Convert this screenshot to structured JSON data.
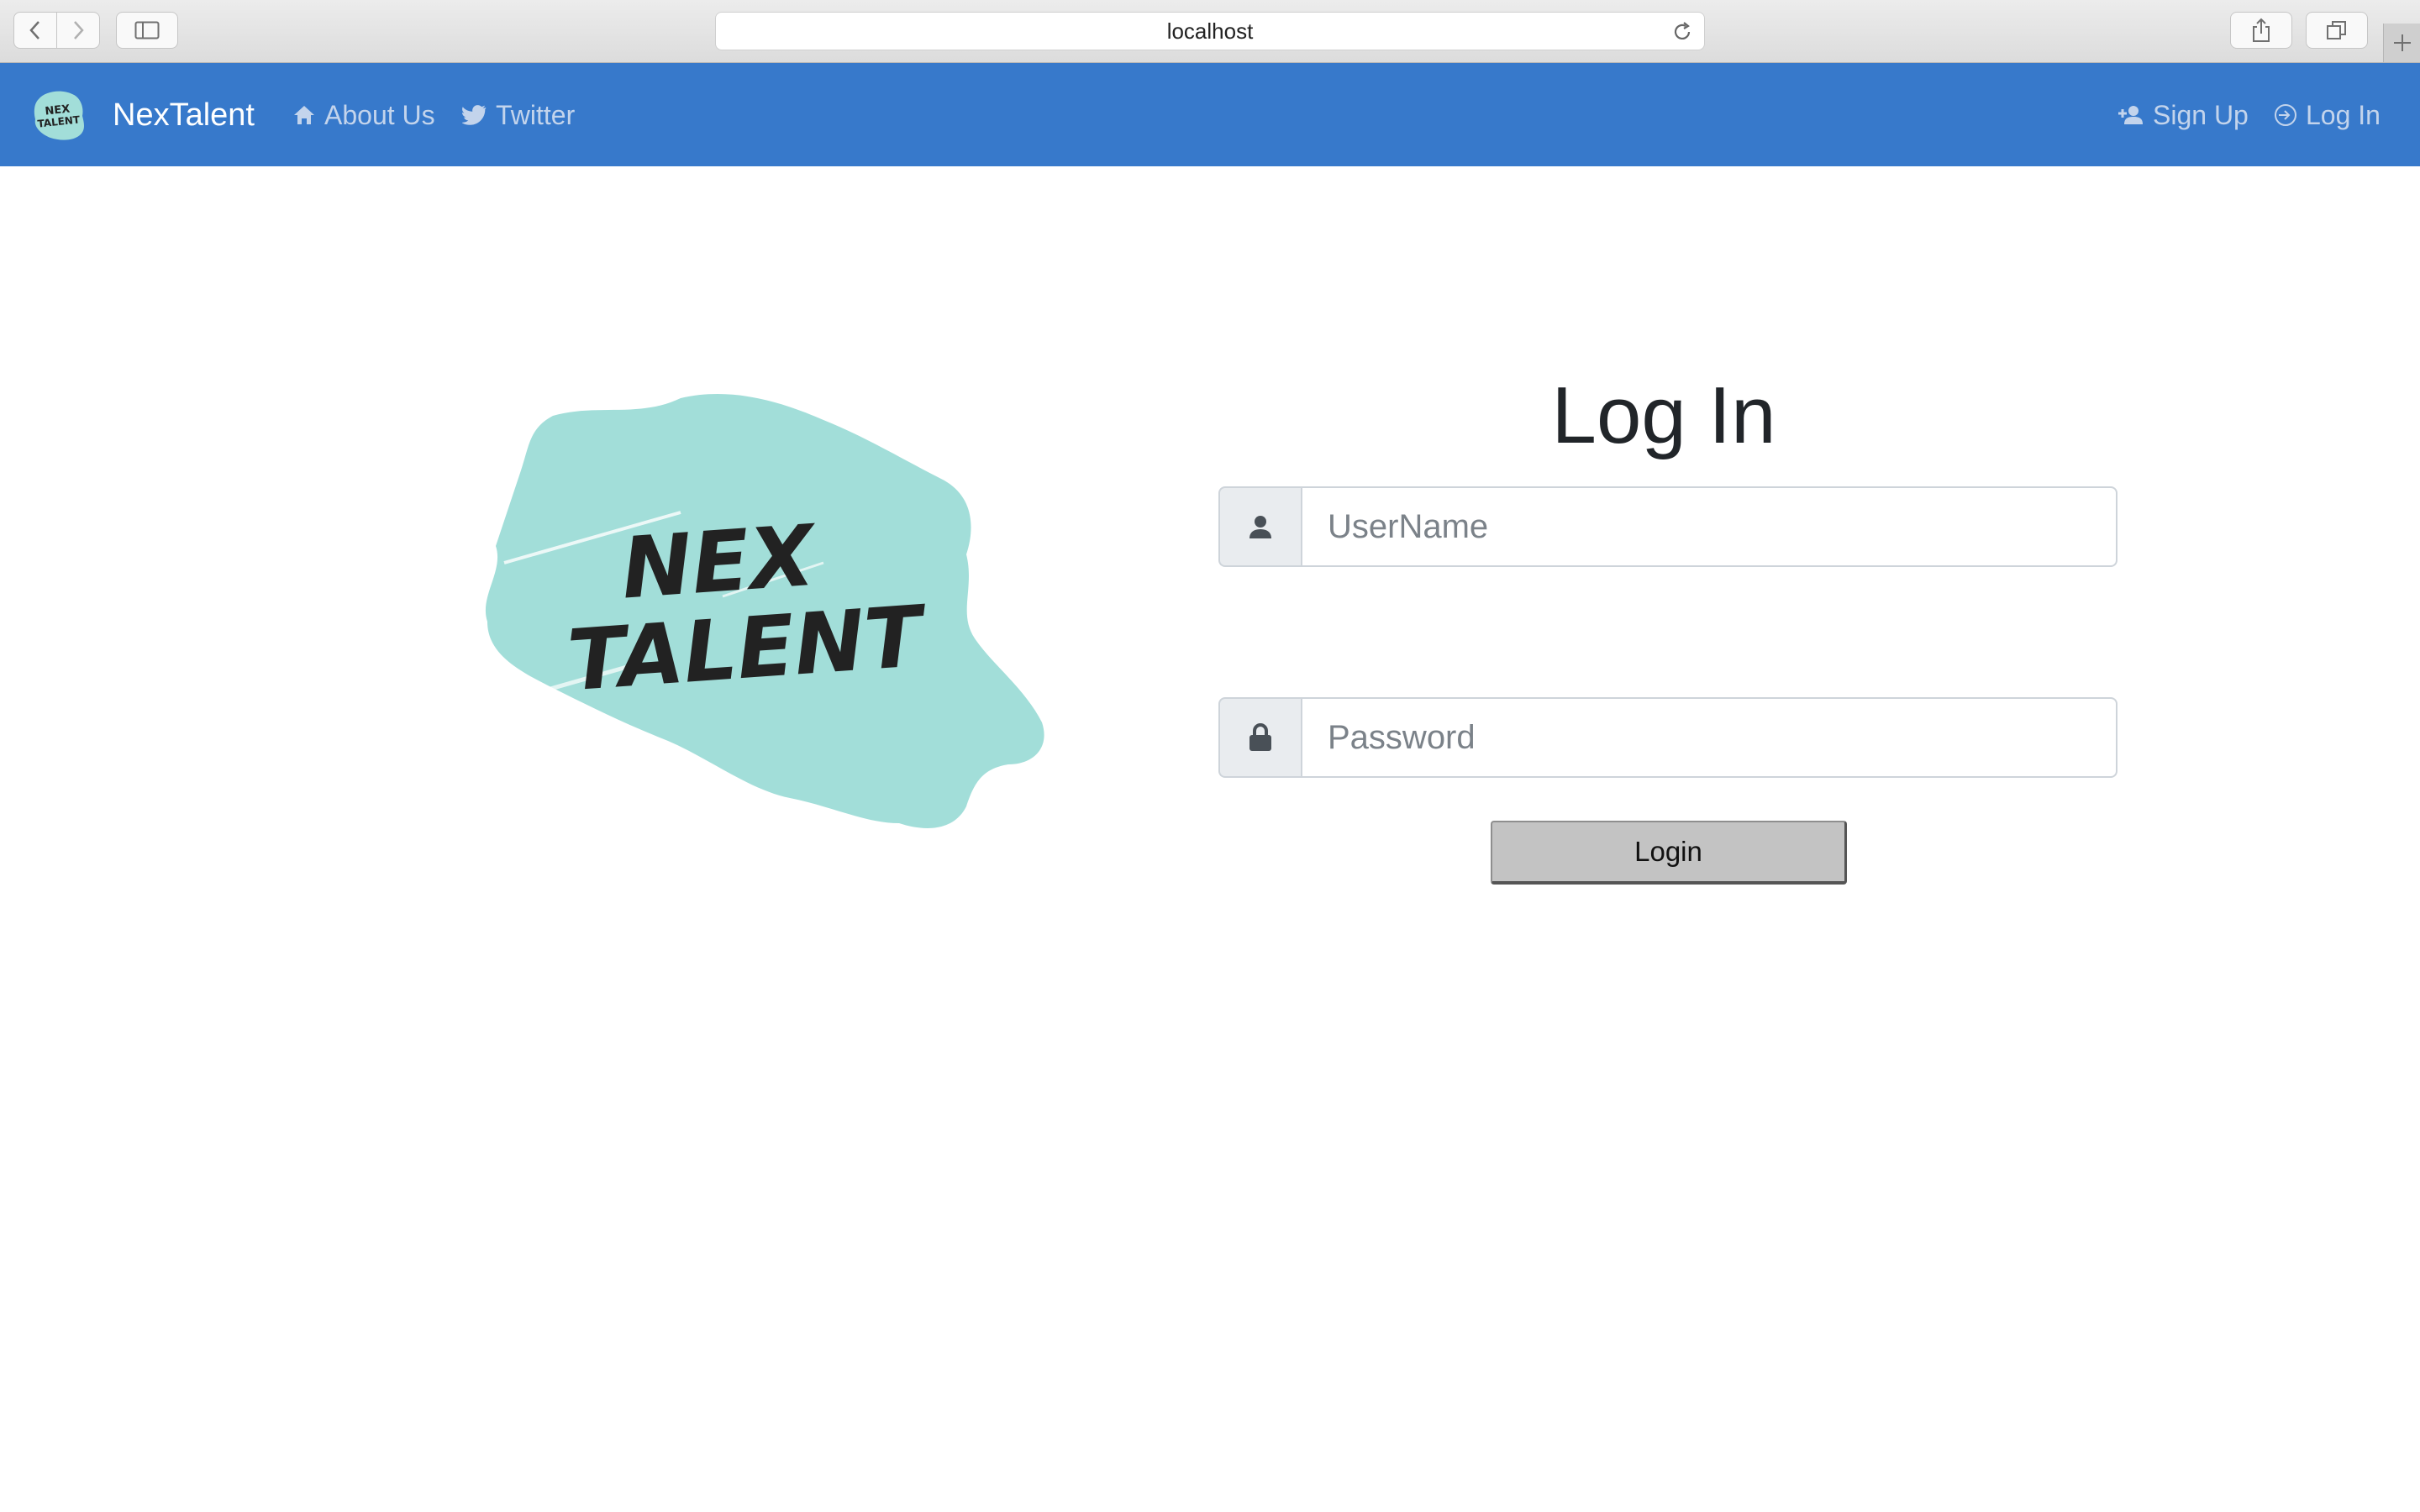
{
  "browser": {
    "url": "localhost",
    "icons": {
      "back": "chevron-left-icon",
      "forward": "chevron-right-icon",
      "sidebar": "sidebar-icon",
      "reload": "reload-icon",
      "share": "share-icon",
      "tabs": "tabs-overview-icon",
      "new_tab": "plus-icon"
    }
  },
  "navbar": {
    "brand": "NexTalent",
    "background": "#3779cb",
    "links": [
      {
        "label": "About Us",
        "icon": "home-icon"
      },
      {
        "label": "Twitter",
        "icon": "twitter-icon"
      }
    ],
    "right_links": [
      {
        "label": "Sign Up",
        "icon": "user-plus-icon"
      },
      {
        "label": "Log In",
        "icon": "log-in-icon"
      }
    ]
  },
  "logo": {
    "line1": "NEX",
    "line2": "TALENT",
    "color": "#a2ded9"
  },
  "login": {
    "title": "Log In",
    "username_placeholder": "UserName",
    "password_placeholder": "Password",
    "username_icon": "user-icon",
    "password_icon": "lock-icon",
    "button_label": "Login"
  }
}
